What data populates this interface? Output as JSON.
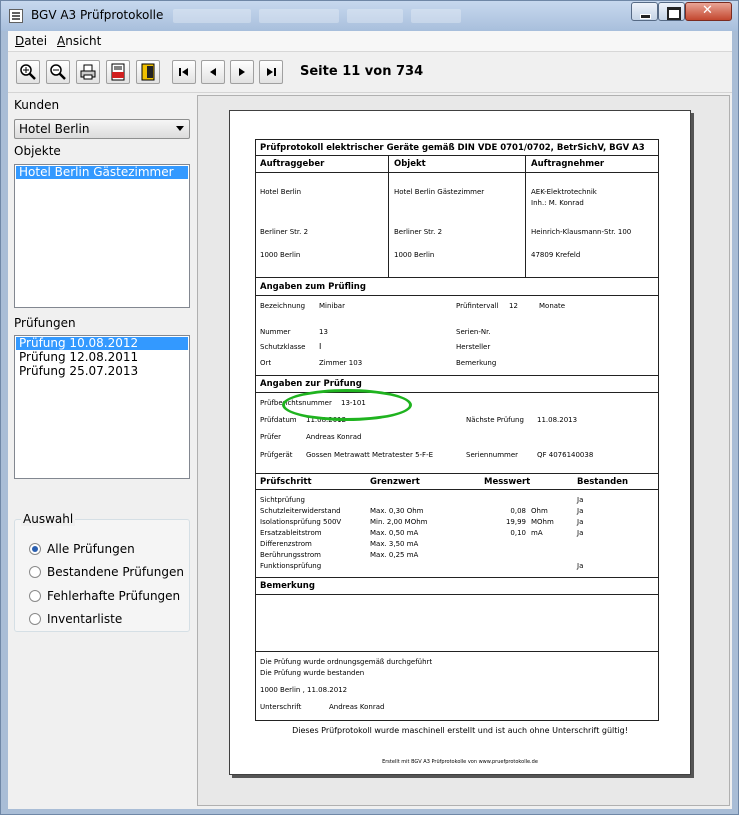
{
  "window": {
    "title": "BGV A3 Prüfprotokolle"
  },
  "menu": {
    "datei_u": "D",
    "datei_rest": "atei",
    "ansicht_u": "A",
    "ansicht_rest": "nsicht"
  },
  "toolbar": {
    "page_info": "Seite 11 von 734"
  },
  "icons": [
    "zoom-in-icon",
    "zoom-out-icon",
    "print-icon",
    "pdf-icon",
    "exit-icon",
    "first-page-icon",
    "prev-page-icon",
    "next-page-icon",
    "last-page-icon"
  ],
  "sidebar": {
    "kunden_label": "Kunden",
    "kunden_value": "Hotel Berlin",
    "objekte_label": "Objekte",
    "objekte": [
      "Hotel Berlin Gästezimmer"
    ],
    "pruefungen_label": "Prüfungen",
    "pruefungen": [
      "Prüfung 10.08.2012",
      "Prüfung 12.08.2011",
      "Prüfung 25.07.2013"
    ],
    "auswahl_label": "Auswahl",
    "auswahl": [
      "Alle Prüfungen",
      "Bestandene Prüfungen",
      "Fehlerhafte Prüfungen",
      "Inventarliste"
    ]
  },
  "doc": {
    "title": "Prüfprotokoll elektrischer Geräte gemäß DIN VDE 0701/0702, BetrSichV, BGV A3",
    "col_auftraggeber": "Auftraggeber",
    "col_objekt": "Objekt",
    "col_auftragnehmer": "Auftragnehmer",
    "ag_name": "Hotel Berlin",
    "ag_street": "Berliner Str. 2",
    "ag_city": "1000 Berlin",
    "obj_name": "Hotel Berlin Gästezimmer",
    "obj_street": "Berliner Str. 2",
    "obj_city": "1000 Berlin",
    "an_name": "AEK-Elektrotechnik",
    "an_inh": "Inh.: M. Konrad",
    "an_street": "Heinrich-Klausmann-Str. 100",
    "an_city": "47809 Krefeld",
    "pruefling_title": "Angaben zum Prüfling",
    "bez_label": "Bezeichnung",
    "bez_value": "Minibar",
    "intervall_label": "Prüfintervall",
    "intervall_value": "12",
    "intervall_unit": "Monate",
    "nummer_label": "Nummer",
    "nummer_value": "13",
    "serien_label": "Serien-Nr.",
    "schutz_label": "Schutzklasse",
    "schutz_value": "I",
    "hersteller_label": "Hersteller",
    "ort_label": "Ort",
    "ort_value": "Zimmer 103",
    "bemerkung_label": "Bemerkung",
    "pruefung_title": "Angaben zur Prüfung",
    "bericht_label": "Prüfberichtsnummer",
    "bericht_value": "13-101",
    "datum_label": "Prüfdatum",
    "datum_value": "11.08.2012",
    "naechste_label": "Nächste Prüfung",
    "naechste_value": "11.08.2013",
    "pruefer_label": "Prüfer",
    "pruefer_value": "Andreas Konrad",
    "geraet_label": "Prüfgerät",
    "geraet_value": "Gossen Metrawatt Metratester 5-F-E",
    "serienno_label": "Seriennummer",
    "serienno_value": "QF 4076140038",
    "th_schritt": "Prüfschritt",
    "th_grenz": "Grenzwert",
    "th_mess": "Messwert",
    "th_best": "Bestanden",
    "rows": [
      {
        "schritt": "Sichtprüfung",
        "grenz": "",
        "mess": "",
        "unit": "",
        "best": "Ja"
      },
      {
        "schritt": "Schutzleiterwiderstand",
        "grenz": "Max. 0,30 Ohm",
        "mess": "0,08",
        "unit": "Ohm",
        "best": "Ja"
      },
      {
        "schritt": "Isolationsprüfung 500V",
        "grenz": "Min. 2,00 MOhm",
        "mess": "19,99",
        "unit": "MOhm",
        "best": "Ja"
      },
      {
        "schritt": "Ersatzableitstrom",
        "grenz": "Max. 0,50 mA",
        "mess": "0,10",
        "unit": "mA",
        "best": "Ja"
      },
      {
        "schritt": "Differenzstrom",
        "grenz": "Max. 3,50 mA",
        "mess": "",
        "unit": "",
        "best": ""
      },
      {
        "schritt": "Berührungsstrom",
        "grenz": "Max. 0,25 mA",
        "mess": "",
        "unit": "",
        "best": ""
      },
      {
        "schritt": "Funktionsprüfung",
        "grenz": "",
        "mess": "",
        "unit": "",
        "best": "Ja"
      }
    ],
    "bemerkung_title": "Bemerkung",
    "result1": "Die Prüfung wurde ordnungsgemäß durchgeführt",
    "result2": "Die Prüfung wurde bestanden",
    "place_date": "1000 Berlin ,  11.08.2012",
    "unterschrift_label": "Unterschrift",
    "unterschrift_value": "Andreas Konrad",
    "footer_note": "Dieses Prüfprotokoll wurde maschinell erstellt und ist auch ohne Unterschrift gültig!",
    "footer_small": "Erstellt mit BGV A3 Prüfprotokolle von www.pruefprotokolle.de"
  }
}
